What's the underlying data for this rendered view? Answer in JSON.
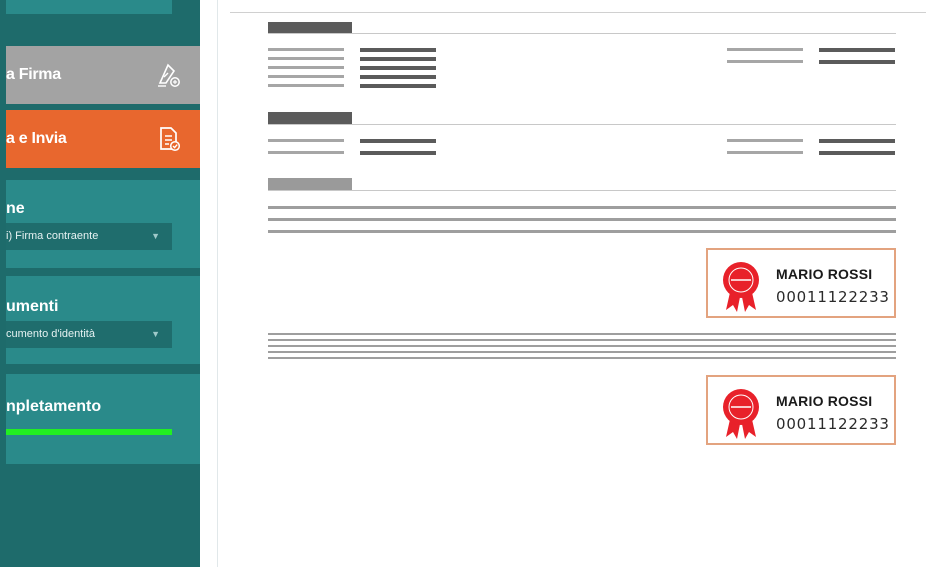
{
  "sidebar": {
    "firma_label": "a Firma",
    "invia_label": "a e Invia",
    "section1": {
      "title": "ne",
      "select_value": "i) Firma contraente"
    },
    "section2": {
      "title": "umenti",
      "select_value": "cumento d'identità"
    },
    "section3": {
      "title": "npletamento",
      "progress": 1.0
    }
  },
  "signatures": [
    {
      "name": "MARIO ROSSI",
      "code": "00011122233"
    },
    {
      "name": "MARIO ROSSI",
      "code": "00011122233"
    }
  ],
  "colors": {
    "sidebar_dark": "#1e6b6b",
    "sidebar_panel": "#2a8a8a",
    "button_gray": "#a3a3a3",
    "button_orange": "#e8672e",
    "progress_green": "#22ef22",
    "seal_red": "#e8212a"
  },
  "icons": [
    "pen-sign-icon",
    "document-check-icon",
    "chevron-down-icon",
    "seal-ribbon-icon"
  ]
}
